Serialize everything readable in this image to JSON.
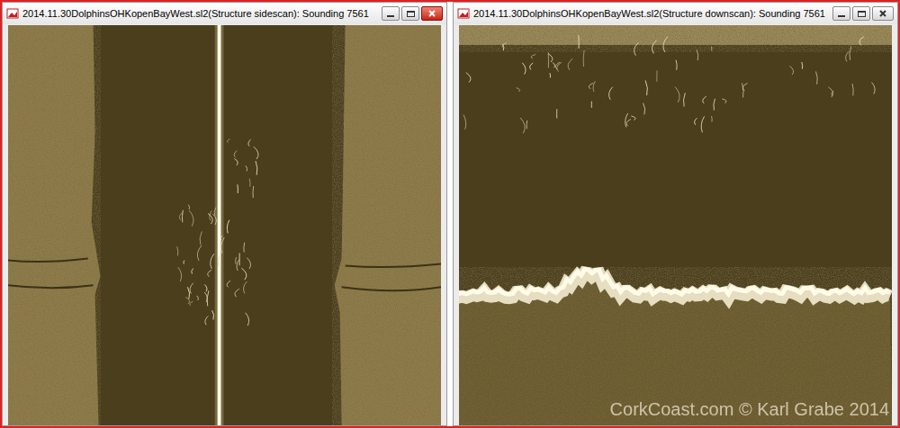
{
  "windows": [
    {
      "title": "2014.11.30DolphinsOHKopenBayWest.sl2(Structure sidescan): Sounding 7561",
      "kind": "sidescan",
      "active": true
    },
    {
      "title": "2014.11.30DolphinsOHKopenBayWest.sl2(Structure downscan): Sounding 7561",
      "kind": "downscan",
      "active": false
    }
  ],
  "watermark": "CorkCoast.com © Karl Grabe 2014"
}
